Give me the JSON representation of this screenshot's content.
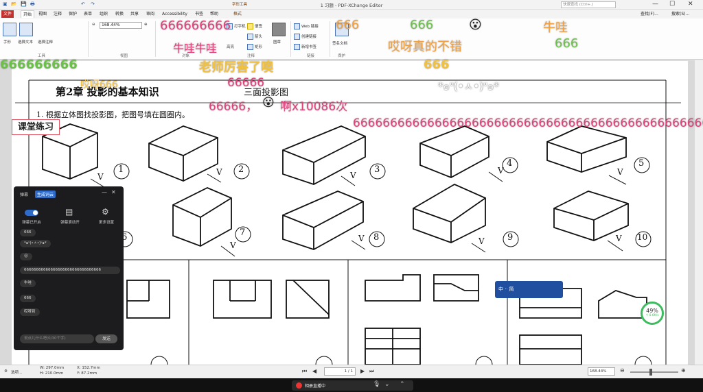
{
  "window": {
    "title": "1 习题 - PDF-XChange Editor",
    "search_placeholder": "快速查找 (Ctrl+.)",
    "minimize": "—",
    "maximize": "☐",
    "close": "✕"
  },
  "ribbon_tabs": {
    "file": "文件",
    "home": "开始",
    "view": "视图",
    "comment": "注释",
    "protect": "保护",
    "form": "表单",
    "organize": "组织",
    "convert": "转换",
    "share": "共享",
    "review": "审阅",
    "accessibility": "Accessibility",
    "bookmark": "书签",
    "help": "帮助",
    "context_group": "字形工具",
    "context_tab": "格式"
  },
  "ribbon": {
    "hand": "手形",
    "select_text": "选择文本",
    "select_comment": "选择注释",
    "zoom_value": "168.44%",
    "page_group": "视图",
    "tools_group": "工具",
    "objects_group": "对象",
    "comment_group": "注释",
    "links_group": "链接",
    "protect_group": "保护",
    "typewriter": "打字机",
    "note": "便签",
    "arrow": "箭头",
    "rectangle": "矩形",
    "highlight": "高亮",
    "stamp": "图章",
    "web_link": "Web 链接",
    "create_link": "创建链接",
    "new_bookmark": "新增书签",
    "sign_doc": "签名文档",
    "find": "查找(F)...",
    "search": "搜索(S)..."
  },
  "document": {
    "chapter": "第2章   投影的基本知识",
    "section": "三面投影图",
    "question": "1. 根据立体图找投影图，把图号填在圆圈内。",
    "lesson_label": "课堂练习",
    "numbers": [
      "1",
      "2",
      "3",
      "4",
      "5",
      "6",
      "7",
      "8",
      "9",
      "10"
    ],
    "v_label": "V"
  },
  "danmaku": {
    "d1": "666666666",
    "d2": "666",
    "d3": "666",
    "d4": "牛哇",
    "d5": "666",
    "d6": "哎呀真的不错",
    "d7": "666666666",
    "d8": "老师厉害了噢",
    "d9": "666",
    "d10": "66666",
    "d11": "66666，",
    "d12": "啊x10086次",
    "d13": "*๑ᐡ(•ㅅ•)ᐡ๑*",
    "d14": "666666666666666666666666666666666666666666666666666",
    "d15": "牛哇牛哇",
    "d16": "哎呀666"
  },
  "panel": {
    "tab_danmaku": "弹幕",
    "tab_cloud": "生成词云",
    "ctl_toggle": "弹幕已开启",
    "ctl_scroll": "弹幕滚动开",
    "ctl_settings": "更多设置",
    "messages": [
      "666",
      "*๑ᐡ(•ㅅ•)ᐡ๑*",
      "😮",
      "66666666666666666666666666666666",
      "牛哇",
      "666",
      "哎呀到"
    ],
    "input_placeholder": "说点儿什么吧(0/30个字)",
    "send": "发送"
  },
  "statusbar": {
    "settings": "选项...",
    "width": "W: 297.0mm",
    "height": "H: 210.0mm",
    "x": "X: 152.7mm",
    "y": "Y: 87.2mm",
    "page": "1 / 1",
    "zoom": "168.44%"
  },
  "overlay": {
    "progress_pct": "49%",
    "speed": "↑ 0.6K/s",
    "live_status": "相册直播中",
    "toolbar_label": "中 ·ᐧ 简"
  },
  "colors": {
    "accent": "#c4302b",
    "danmaku_pink": "#e0407a",
    "danmaku_orange": "#f0a040",
    "danmaku_green": "#6cc04a"
  }
}
